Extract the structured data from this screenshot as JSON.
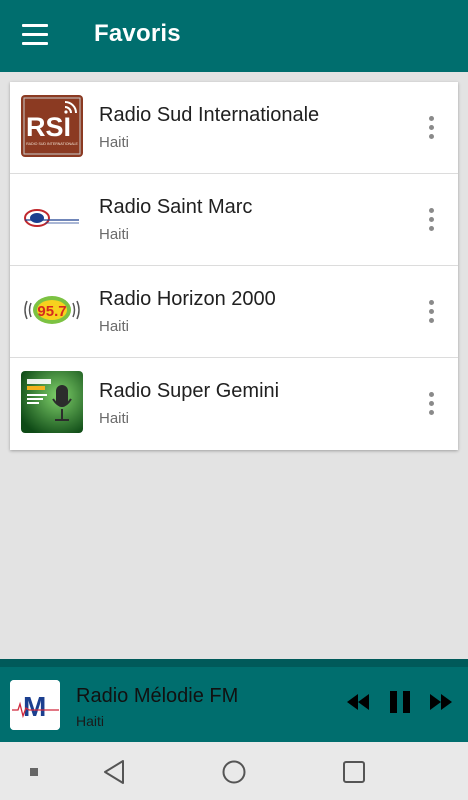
{
  "appbar": {
    "title": "Favoris",
    "menu_icon": "hamburger-menu-icon"
  },
  "stations": [
    {
      "name": "Radio Sud Internationale",
      "country": "Haiti",
      "logo_text": "RSI",
      "logo_small": "RADIO SUD INTERNATIONALE"
    },
    {
      "name": "Radio Saint Marc",
      "country": "Haiti"
    },
    {
      "name": "Radio Horizon 2000",
      "country": "Haiti",
      "logo_text": "95.7"
    },
    {
      "name": "Radio Super Gemini",
      "country": "Haiti"
    }
  ],
  "player": {
    "title": "Radio Mélodie FM",
    "subtitle": "Haiti",
    "logo_text": "M"
  },
  "colors": {
    "primary": "#006e6e",
    "primary_dark": "#005a5a",
    "background": "#e3e3e3"
  }
}
